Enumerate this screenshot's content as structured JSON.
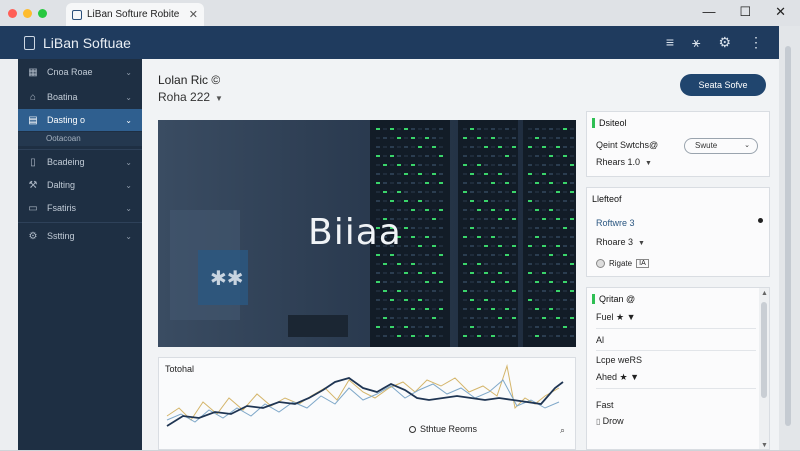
{
  "colors": {
    "header": "#1f3b5e",
    "sidebar": "#1e2f43",
    "sidebar_active": "#2f5f8f",
    "accent_green": "#2fbf54",
    "primary_button": "#20456e"
  },
  "browser": {
    "tab_title": "LiBan Softure Robite",
    "tab_close": "✕",
    "controls": {
      "minimize": "—",
      "maximize": "☐",
      "close": "✕"
    }
  },
  "app": {
    "title": "LiBan Softuae",
    "actions": [
      "list-icon",
      "collaborators-icon",
      "settings-icon",
      "more-icon"
    ]
  },
  "sidebar": {
    "items": [
      {
        "label": "Cnoa Roae",
        "icon": "grid-icon"
      },
      {
        "label": "Boatina",
        "icon": "home-icon"
      },
      {
        "label": "Dasting o",
        "icon": "chart-icon"
      },
      {
        "label": "Bcadeing",
        "icon": "document-icon"
      },
      {
        "label": "Dalting",
        "icon": "tools-icon"
      },
      {
        "label": "Fsatiris",
        "icon": "folder-icon"
      },
      {
        "label": "Sstting",
        "icon": "gear-icon"
      }
    ],
    "sub_label": "Ootacoan"
  },
  "main": {
    "heading_1": "Lolan Ric ©",
    "heading_2": "Roha 222",
    "primary_button": "Seata Sofve",
    "hero_title": "Biiaa",
    "trend": {
      "title": "Totohal",
      "legend_label": "Sthtue Reoms"
    }
  },
  "panels": {
    "p1": {
      "title": "Dsiteol",
      "row1": "Qeint Swtchs@",
      "row2": "Rhears 1.0",
      "pill_label": "Swute"
    },
    "p2": {
      "title": "Llefteof",
      "row1": "Roftwre 3",
      "row2": "Rhoare 3",
      "chip_label": "Rigate",
      "chip_box": "IA"
    },
    "p3": {
      "title": "Qritan @",
      "rows": [
        "Fuel ★ ▼",
        "Al",
        "Lcpe weRS",
        "Ahed ★ ▼",
        "Fast",
        "Drow"
      ]
    }
  }
}
